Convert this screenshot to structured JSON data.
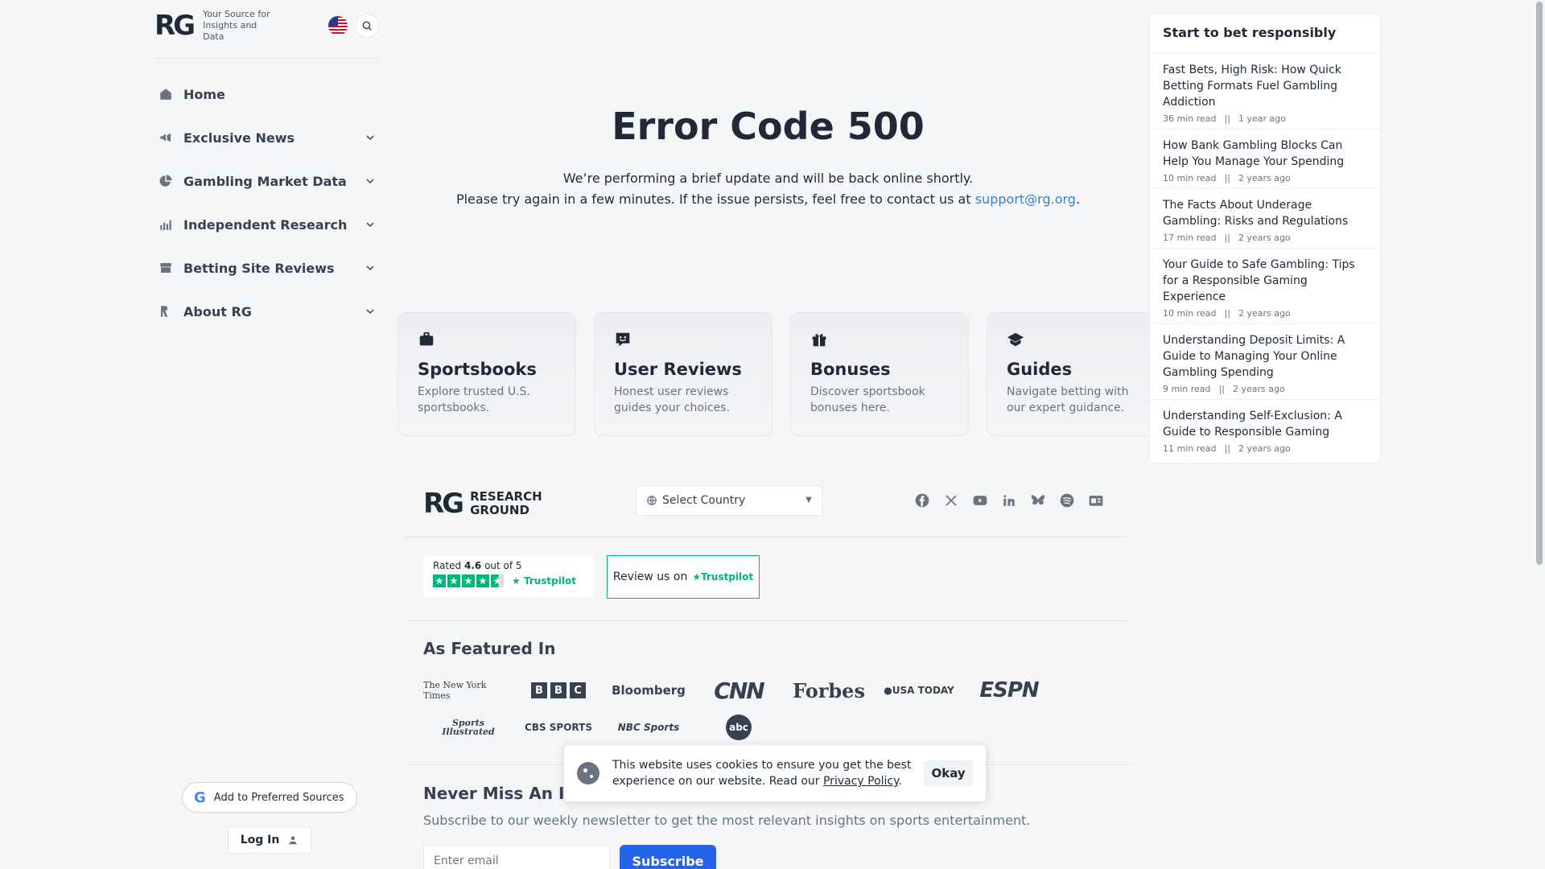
{
  "brand": {
    "logo": "RG",
    "tagline": "Your Source for Insights and Data"
  },
  "sidebar": {
    "items": [
      {
        "label": "Home",
        "icon": "home-icon"
      },
      {
        "label": "Exclusive News",
        "icon": "megaphone-icon"
      },
      {
        "label": "Gambling Market Data",
        "icon": "pie-chart-icon"
      },
      {
        "label": "Independent Research",
        "icon": "bar-chart-icon"
      },
      {
        "label": "Betting Site Reviews",
        "icon": "box-icon"
      },
      {
        "label": "About RG",
        "icon": "rg-icon"
      }
    ],
    "preferred_sources": "Add to Preferred Sources",
    "login": "Log In"
  },
  "error": {
    "title": "Error Code 500",
    "line1": "We’re performing a brief update and will be back online shortly.",
    "line2_prefix": "Please try again in a few minutes. If the issue persists, feel free to contact us at",
    "email": "support@rg.org",
    "line2_suffix": "."
  },
  "cards": [
    {
      "title": "Sportsbooks",
      "desc": "Explore trusted U.S. sportsbooks."
    },
    {
      "title": "User Reviews",
      "desc": "Honest user reviews guides your choices."
    },
    {
      "title": "Bonuses",
      "desc": "Discover sportsbook bonuses here."
    },
    {
      "title": "Guides",
      "desc": "Navigate betting with our expert guidance."
    }
  ],
  "footer": {
    "logo_mark": "RG",
    "logo_line1": "RESEARCH",
    "logo_line2": "GROUND",
    "country_placeholder": "Select Country",
    "trustpilot": {
      "rated_prefix": "Rated",
      "score": "4.6",
      "rated_suffix": "out of 5",
      "brand": "Trustpilot",
      "review_label": "Review us on"
    },
    "featured_title": "As Featured In",
    "featured_logos": {
      "nyt": "The New York Times",
      "bbc": [
        "B",
        "B",
        "C"
      ],
      "bloomberg": "Bloomberg",
      "cnn": "CNN",
      "forbes": "Forbes",
      "usatoday": "USA TODAY",
      "espn": "ESPN",
      "si_line1": "Sports",
      "si_line2": "Illustrated",
      "cbs": "CBS SPORTS",
      "nbc": "NBC Sports",
      "abc": "abc"
    },
    "newsletter_title": "Never Miss An I",
    "newsletter_sub": "Subscribe to our weekly newsletter to get the most relevant insights on sports entertainment.",
    "email_placeholder": "Enter email",
    "subscribe": "Subscribe"
  },
  "panel": {
    "title": "Start to bet responsibly",
    "articles": [
      {
        "title": "Fast Bets, High Risk: How Quick Betting Formats Fuel Gambling Addiction",
        "read": "36 min read",
        "age": "1 year ago"
      },
      {
        "title": "How Bank Gambling Blocks Can Help You Manage Your Spending",
        "read": "10 min read",
        "age": "2 years ago"
      },
      {
        "title": "The Facts About Underage Gambling: Risks and Regulations",
        "read": "17 min read",
        "age": "2 years ago"
      },
      {
        "title": "Your Guide to Safe Gambling: Tips for a Responsible Gaming Experience",
        "read": "10 min read",
        "age": "2 years ago"
      },
      {
        "title": "Understanding Deposit Limits: A Guide to Managing Your Online Gambling Spending",
        "read": "9 min read",
        "age": "2 years ago"
      },
      {
        "title": "Understanding Self-Exclusion: A Guide to Responsible Gaming",
        "read": "11 min read",
        "age": "2 years ago"
      }
    ],
    "meta_sep": "||"
  },
  "cookie": {
    "text": "This website uses cookies to ensure you get the best experience on our website. Read our",
    "link": "Privacy Policy",
    "suffix": ".",
    "ok": "Okay"
  }
}
